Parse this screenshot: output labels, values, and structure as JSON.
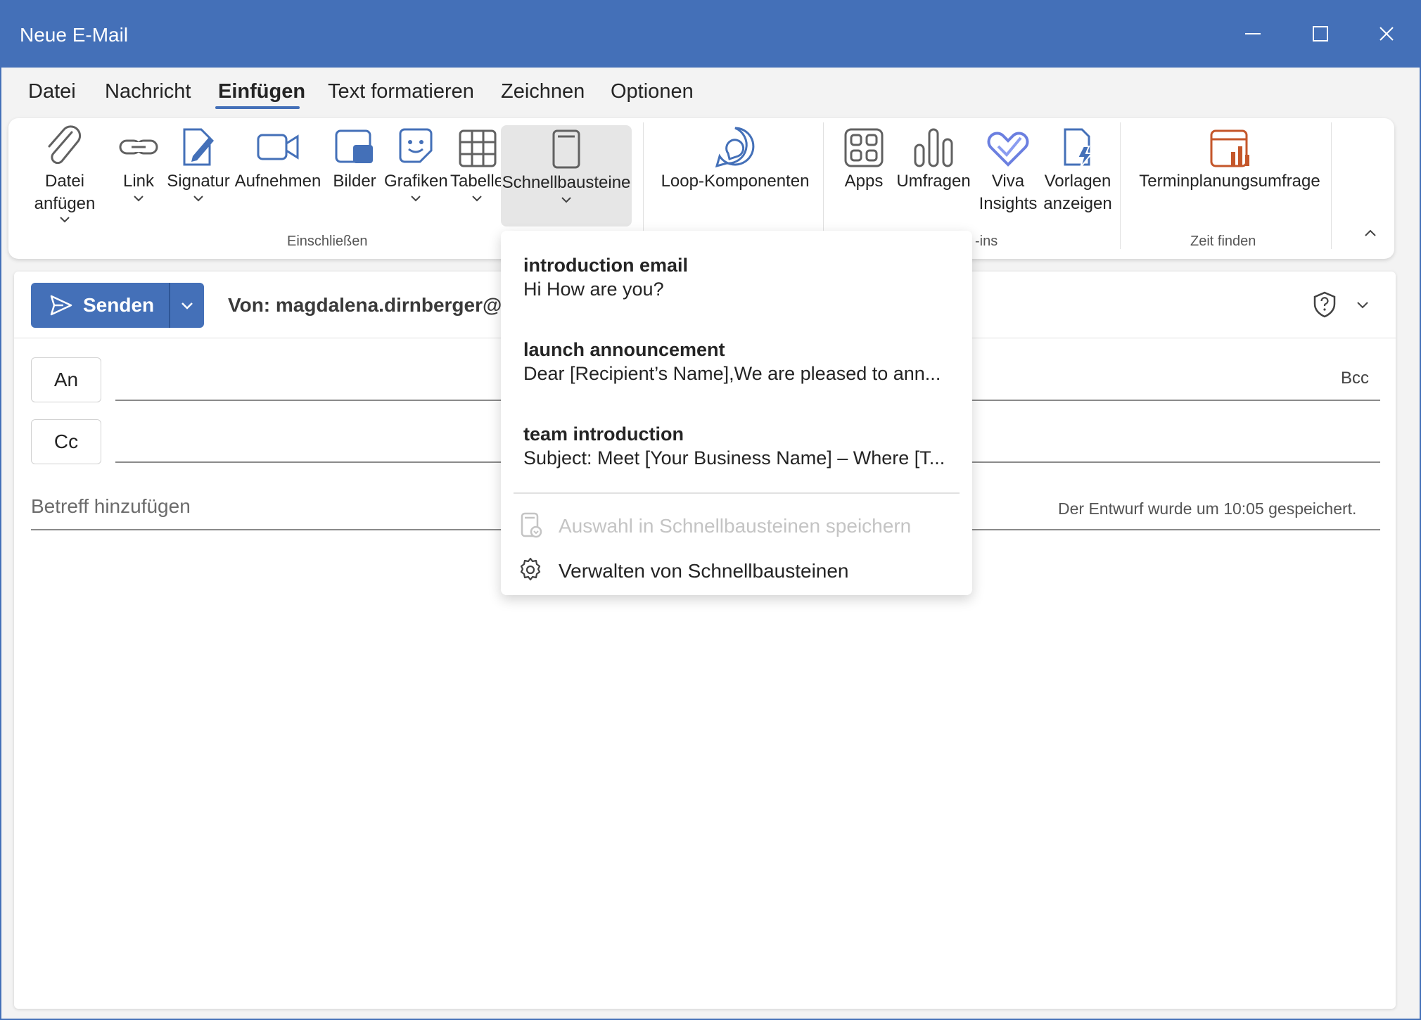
{
  "window": {
    "title": "Neue E-Mail"
  },
  "menu": {
    "items": [
      "Datei",
      "Nachricht",
      "Einfügen",
      "Text formatieren",
      "Zeichnen",
      "Optionen"
    ],
    "active": "Einfügen"
  },
  "ribbon": {
    "buttons": {
      "datei_anfuegen": {
        "line1": "Datei",
        "line2": "anfügen"
      },
      "link": "Link",
      "signatur": "Signatur",
      "aufnehmen": "Aufnehmen",
      "bilder": "Bilder",
      "grafiken": "Grafiken",
      "tabelle": "Tabelle",
      "schnellbausteine": "Schnellbausteine",
      "loop": "Loop-Komponenten",
      "apps": "Apps",
      "umfragen": "Umfragen",
      "viva": {
        "line1": "Viva",
        "line2": "Insights"
      },
      "vorlagen": {
        "line1": "Vorlagen",
        "line2": "anzeigen"
      },
      "terminplanung": "Terminplanungsumfrage"
    },
    "groups": {
      "einschliessen": "Einschließen",
      "addins": "-ins",
      "zeit_finden": "Zeit finden"
    }
  },
  "compose": {
    "send_label": "Senden",
    "from": "Von: magdalena.dirnberger@u",
    "to_label": "An",
    "cc_label": "Cc",
    "bcc_label": "Bcc",
    "subject_placeholder": "Betreff hinzufügen",
    "saved_status": "Der Entwurf wurde um 10:05 gespeichert."
  },
  "quickparts": {
    "items": [
      {
        "title": "introduction email",
        "preview": "Hi How are you?"
      },
      {
        "title": "launch announcement",
        "preview": "Dear [Recipient’s Name],We are pleased to ann..."
      },
      {
        "title": "team introduction",
        "preview": "Subject: Meet [Your Business Name] – Where [T..."
      }
    ],
    "save_selection": "Auswahl in Schnellbausteinen speichern",
    "manage": "Verwalten von Schnellbausteinen"
  },
  "colors": {
    "accent": "#4470b8",
    "orange": "#c4562a"
  }
}
